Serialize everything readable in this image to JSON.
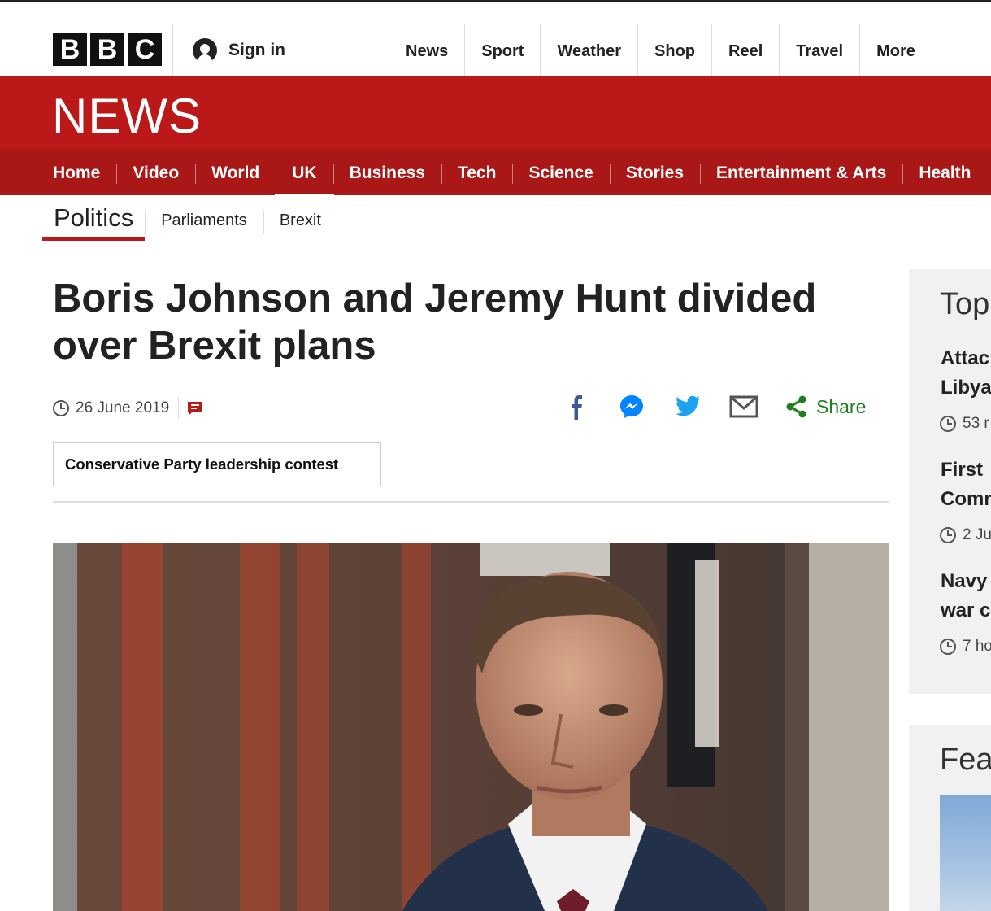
{
  "masthead": {
    "logo": [
      "B",
      "B",
      "C"
    ],
    "sign_in": "Sign in",
    "nav": [
      "News",
      "Sport",
      "Weather",
      "Shop",
      "Reel",
      "Travel",
      "More"
    ]
  },
  "news_banner": {
    "title": "NEWS"
  },
  "main_nav": {
    "items": [
      "Home",
      "Video",
      "World",
      "UK",
      "Business",
      "Tech",
      "Science",
      "Stories",
      "Entertainment & Arts",
      "Health"
    ],
    "active": "UK"
  },
  "sub_nav": {
    "primary": "Politics",
    "items": [
      "Parliaments",
      "Brexit"
    ]
  },
  "article": {
    "headline": "Boris Johnson and Jeremy Hunt divided over Brexit plans",
    "date": "26 June 2019",
    "share_label": "Share",
    "tag": "Conservative Party leadership contest"
  },
  "sidebar": {
    "top_title": "Top",
    "stories": [
      {
        "line1": "Attac",
        "line2": "Libya",
        "time": "53 r"
      },
      {
        "line1": "First",
        "line2": "Comm",
        "time": "2 Ju"
      },
      {
        "line1": "Navy",
        "line2": "war c",
        "time": "7 ho"
      }
    ],
    "features_title": "Fea"
  },
  "colors": {
    "brand_red": "#bb1919",
    "nav_red": "#a91717",
    "share_green": "#1d7f1d"
  },
  "icons": [
    "user-icon",
    "clock-icon",
    "comment-icon",
    "facebook-icon",
    "messenger-icon",
    "twitter-icon",
    "email-icon",
    "share-icon"
  ]
}
